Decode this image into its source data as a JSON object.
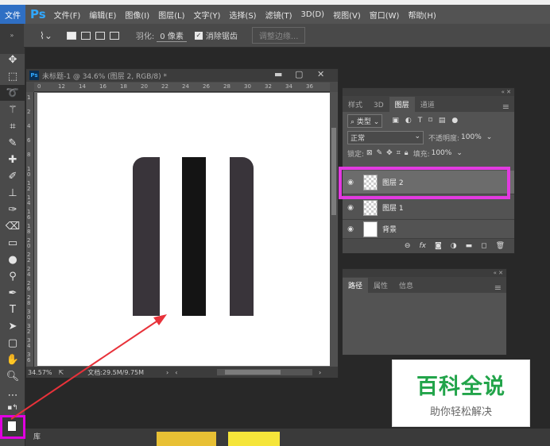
{
  "menubar": {
    "file_tab": "文件",
    "logo": "Ps",
    "items": [
      "文件(F)",
      "编辑(E)",
      "图像(I)",
      "图层(L)",
      "文字(Y)",
      "选择(S)",
      "滤镜(T)",
      "3D(D)",
      "视图(V)",
      "窗口(W)",
      "帮助(H)"
    ]
  },
  "options": {
    "feather_label": "羽化:",
    "feather_value": "0 像素",
    "antialias_label": "消除锯齿",
    "refine_edge_label": "调整边缘..."
  },
  "document": {
    "title": "未标题-1 @ 34.6% (图层 2, RGB/8) *",
    "zoom": "34.57%",
    "doc_size": "文档:29.5M/9.75M",
    "ruler_top": [
      "0",
      "12",
      "14",
      "16",
      "18",
      "20",
      "22",
      "24",
      "26",
      "28",
      "30",
      "32",
      "34",
      "36"
    ],
    "ruler_left": [
      "1",
      "2",
      "4",
      "6",
      "8",
      "1 0",
      "1 2",
      "1 4",
      "1 6",
      "1 8",
      "2 0",
      "2 2",
      "2 4",
      "2 6",
      "2 8",
      "3 0",
      "3 2",
      "3 4",
      "3 6"
    ]
  },
  "shape": {
    "colors": {
      "base": "#39343a",
      "white": "#ffffff",
      "black": "#141414"
    }
  },
  "layers_panel": {
    "tabs": [
      "样式",
      "3D",
      "图层",
      "通道"
    ],
    "active_tab": "图层",
    "filter_kind": "类型",
    "blend_mode": "正常",
    "opacity_label": "不透明度:",
    "opacity_value": "100%",
    "lock_label": "锁定:",
    "fill_label": "填充:",
    "fill_value": "100%",
    "layers": [
      {
        "name": "图层 2",
        "selected": true
      },
      {
        "name": "图层 1",
        "selected": false
      },
      {
        "name": "背景",
        "selected": false
      }
    ],
    "footer_icons": [
      "link-icon",
      "fx-icon",
      "mask-icon",
      "adjustment-icon",
      "group-icon",
      "new-layer-icon",
      "delete-icon"
    ]
  },
  "paths_panel": {
    "tabs": [
      "路径",
      "属性",
      "信息"
    ],
    "active_tab": "路径"
  },
  "watermark": {
    "main": "百科全说",
    "sub": "助你轻松解决"
  },
  "annotation": {
    "arrow_color": "#e8323a",
    "highlight_color": "#e23ae0"
  }
}
